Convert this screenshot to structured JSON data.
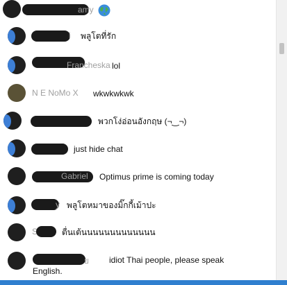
{
  "chat": {
    "messages": [
      {
        "author_fragment": "amy",
        "text": "",
        "emoji": "globe-icon"
      },
      {
        "author_fragment": "i",
        "text": "พลูโตที่รัก"
      },
      {
        "author_fragment": "Francheska",
        "text": "lol"
      },
      {
        "author_fragment": "N E NoMo X",
        "text": "wkwkwkwk"
      },
      {
        "author_fragment": "",
        "text": "พวกโง่อ่อนอังกฤษ  (¬‿¬)"
      },
      {
        "author_fragment": "",
        "text": "just hide chat"
      },
      {
        "author_fragment": "Gabriel",
        "text": "Optimus prime is coming today"
      },
      {
        "author_fragment": "y",
        "text": "พลูโตหมาของมิ๊กกี้เม้าปะ"
      },
      {
        "author_fragment": "S",
        "text": "ตื่นเต้นนนนนนนนนนนนน"
      },
      {
        "author_fragment": "ย",
        "text": "idiot Thai people, please speak English."
      }
    ]
  },
  "colors": {
    "redaction": "#1a1a1a",
    "avatar_ring": "#3d7fd6",
    "bottom_bar": "#2f7fcf"
  }
}
